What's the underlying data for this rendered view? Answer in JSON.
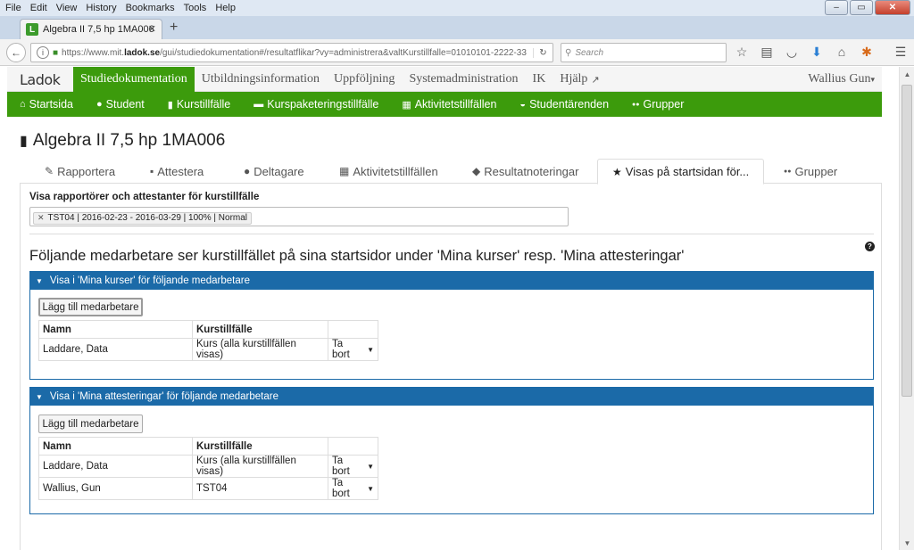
{
  "browser": {
    "menu": [
      "File",
      "Edit",
      "View",
      "History",
      "Bookmarks",
      "Tools",
      "Help"
    ],
    "tab_title": "Algebra II 7,5 hp 1MA006",
    "favicon_letter": "L",
    "url_prefix": "https://www.mit.",
    "url_domain": "ladok.se",
    "url_path": "/gui/studiedokumentation#/resultatflikar?vy=administrera&valtKurstillfalle=01010101-2222-33",
    "search_placeholder": "Search",
    "new_tab": "+",
    "minimize": "–",
    "maximize": "▭",
    "close": "✕"
  },
  "app": {
    "logo": "Ladok",
    "topnav": [
      "Studiedokumentation",
      "Utbildningsinformation",
      "Uppföljning",
      "Systemadministration",
      "IK",
      "Hjälp"
    ],
    "user": "Wallius Gun",
    "subnav": [
      {
        "icon": "home-icon",
        "glyph": "⌂",
        "label": "Startsida"
      },
      {
        "icon": "user-icon",
        "glyph": "●",
        "label": "Student"
      },
      {
        "icon": "book-icon",
        "glyph": "▮",
        "label": "Kurstillfälle"
      },
      {
        "icon": "folder-icon",
        "glyph": "▬",
        "label": "Kurspaketeringstillfälle"
      },
      {
        "icon": "calendar-icon",
        "glyph": "▦",
        "label": "Aktivitetstillfällen"
      },
      {
        "icon": "inbox-icon",
        "glyph": "◒",
        "label": "Studentärenden"
      },
      {
        "icon": "users-icon",
        "glyph": "●●",
        "label": "Grupper"
      }
    ]
  },
  "page": {
    "title": "Algebra II 7,5 hp 1MA006",
    "tabs": [
      {
        "icon": "pencil-icon",
        "glyph": "✎",
        "label": "Rapportera"
      },
      {
        "icon": "stamp-icon",
        "glyph": "▪",
        "label": "Attestera"
      },
      {
        "icon": "user-icon",
        "glyph": "●",
        "label": "Deltagare"
      },
      {
        "icon": "calendar-icon",
        "glyph": "▦",
        "label": "Aktivitetstillfällen"
      },
      {
        "icon": "tag-icon",
        "glyph": "◆",
        "label": "Resultatnoteringar"
      },
      {
        "icon": "star-icon",
        "glyph": "★",
        "label": "Visas på startsidan för..."
      },
      {
        "icon": "users-icon",
        "glyph": "●●",
        "label": "Grupper"
      }
    ],
    "filter_label": "Visa rapportörer och attestanter för kurstillfälle",
    "filter_chip": "TST04 | 2016-02-23 - 2016-03-29 | 100% | Normal",
    "heading": "Följande medarbetare ser kurstillfället på sina startsidor under 'Mina kurser' resp. 'Mina attesteringar'",
    "help_glyph": "?",
    "panels": [
      {
        "title": "Visa i 'Mina kurser' för följande medarbetare",
        "add_label": "Lägg till medarbetare",
        "col_name": "Namn",
        "col_course": "Kurstillfälle",
        "rows": [
          {
            "name": "Laddare, Data",
            "course": "Kurs (alla kurstillfällen visas)",
            "action": "Ta bort"
          }
        ]
      },
      {
        "title": "Visa i 'Mina attesteringar' för följande medarbetare",
        "add_label": "Lägg till medarbetare",
        "col_name": "Namn",
        "col_course": "Kurstillfälle",
        "rows": [
          {
            "name": "Laddare, Data",
            "course": "Kurs (alla kurstillfällen visas)",
            "action": "Ta bort"
          },
          {
            "name": "Wallius, Gun",
            "course": "TST04",
            "action": "Ta bort"
          }
        ]
      }
    ]
  }
}
